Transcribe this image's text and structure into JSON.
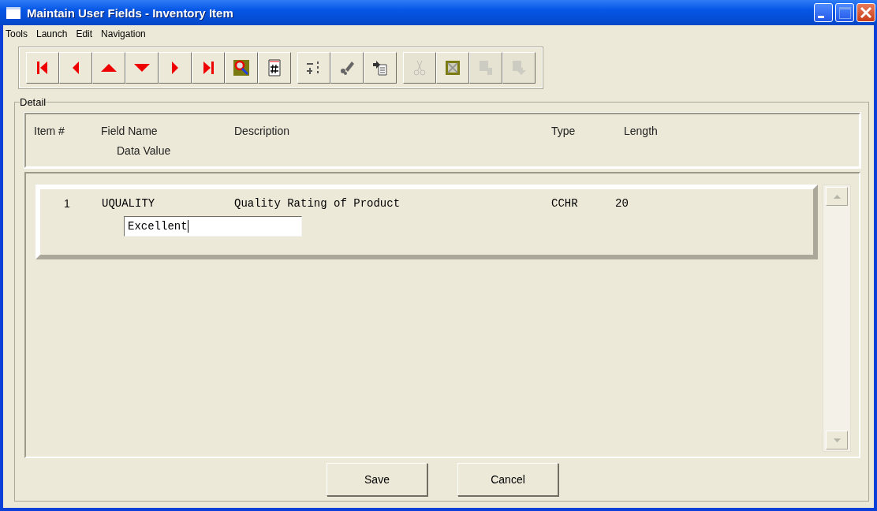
{
  "window": {
    "title": "Maintain User Fields - Inventory Item"
  },
  "menu": [
    "Tools",
    "Launch",
    "Edit",
    "Navigation"
  ],
  "toolbar": [
    [
      {
        "kind": "first",
        "disabled": false
      },
      {
        "kind": "previous",
        "disabled": false
      },
      {
        "kind": "up",
        "disabled": false
      },
      {
        "kind": "down",
        "disabled": false
      },
      {
        "kind": "next",
        "disabled": false
      },
      {
        "kind": "last",
        "disabled": false
      },
      {
        "kind": "find",
        "disabled": false
      },
      {
        "kind": "number",
        "disabled": false
      }
    ],
    [
      {
        "kind": "insert",
        "disabled": false
      },
      {
        "kind": "erase",
        "disabled": false
      },
      {
        "kind": "paste",
        "disabled": false
      }
    ],
    [
      {
        "kind": "cut",
        "disabled": true
      },
      {
        "kind": "delete",
        "disabled": false
      },
      {
        "kind": "copy",
        "disabled": true
      },
      {
        "kind": "copy-down",
        "disabled": true
      }
    ]
  ],
  "detail": {
    "label": "Detail",
    "columns": [
      {
        "label": "Item #"
      },
      {
        "label": "Field Name"
      },
      {
        "label": "Description"
      },
      {
        "label": "Type"
      },
      {
        "label": "Length"
      }
    ],
    "subheading": "Data Value",
    "rows": [
      {
        "item": "1",
        "field_name": "UQUALITY",
        "description": "Quality Rating of Product",
        "type": "CCHR",
        "length": "20",
        "data_value": "Excellent"
      }
    ]
  },
  "buttons": [
    "Save",
    "Cancel"
  ]
}
